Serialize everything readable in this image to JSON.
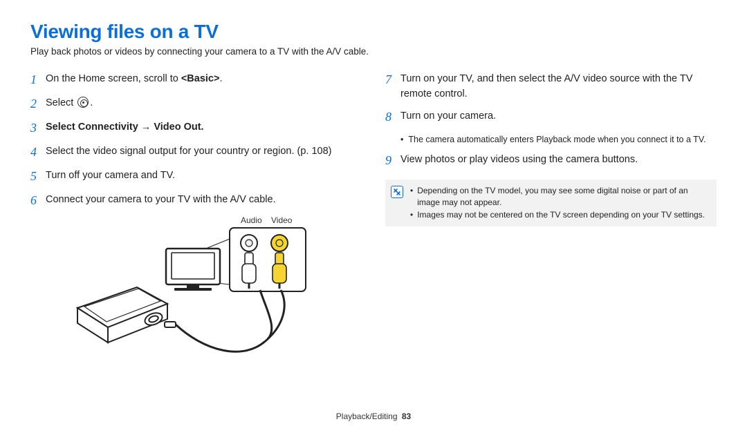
{
  "title": "Viewing files on a TV",
  "intro": "Play back photos or videos by connecting your camera to a TV with the A/V cable.",
  "left_steps": [
    {
      "n": "1",
      "html_parts": [
        "On the Home screen, scroll to ",
        "<b>&lt;Basic&gt;</b>",
        "."
      ]
    },
    {
      "n": "2",
      "html_parts": [
        "Select ",
        "{icon}",
        "."
      ]
    },
    {
      "n": "3",
      "bold": true,
      "html_parts": [
        "Select ",
        "<b>Connectivity</b>",
        " &rarr; ",
        "<b>Video Out</b>",
        "."
      ]
    },
    {
      "n": "4",
      "html_parts": [
        "Select the video signal output for your country or region. (p. 108)"
      ]
    },
    {
      "n": "5",
      "html_parts": [
        "Turn off your camera and TV."
      ]
    },
    {
      "n": "6",
      "html_parts": [
        "Connect your camera to your TV with the A/V cable."
      ]
    }
  ],
  "diagram_labels": {
    "audio": "Audio",
    "video": "Video"
  },
  "right_steps": [
    {
      "n": "7",
      "html_parts": [
        "Turn on your TV, and then select the A/V video source with the TV remote control."
      ]
    },
    {
      "n": "8",
      "html_parts": [
        "Turn on your camera."
      ],
      "sub": [
        "The camera automatically enters Playback mode when you connect it to a TV."
      ]
    },
    {
      "n": "9",
      "html_parts": [
        "View photos or play videos using the camera buttons."
      ]
    }
  ],
  "notes": [
    "Depending on the TV model, you may see some digital noise or part of an image may not appear.",
    "Images may not be centered on the TV screen depending on your TV settings."
  ],
  "footer_section": "Playback/Editing",
  "footer_page": "83"
}
